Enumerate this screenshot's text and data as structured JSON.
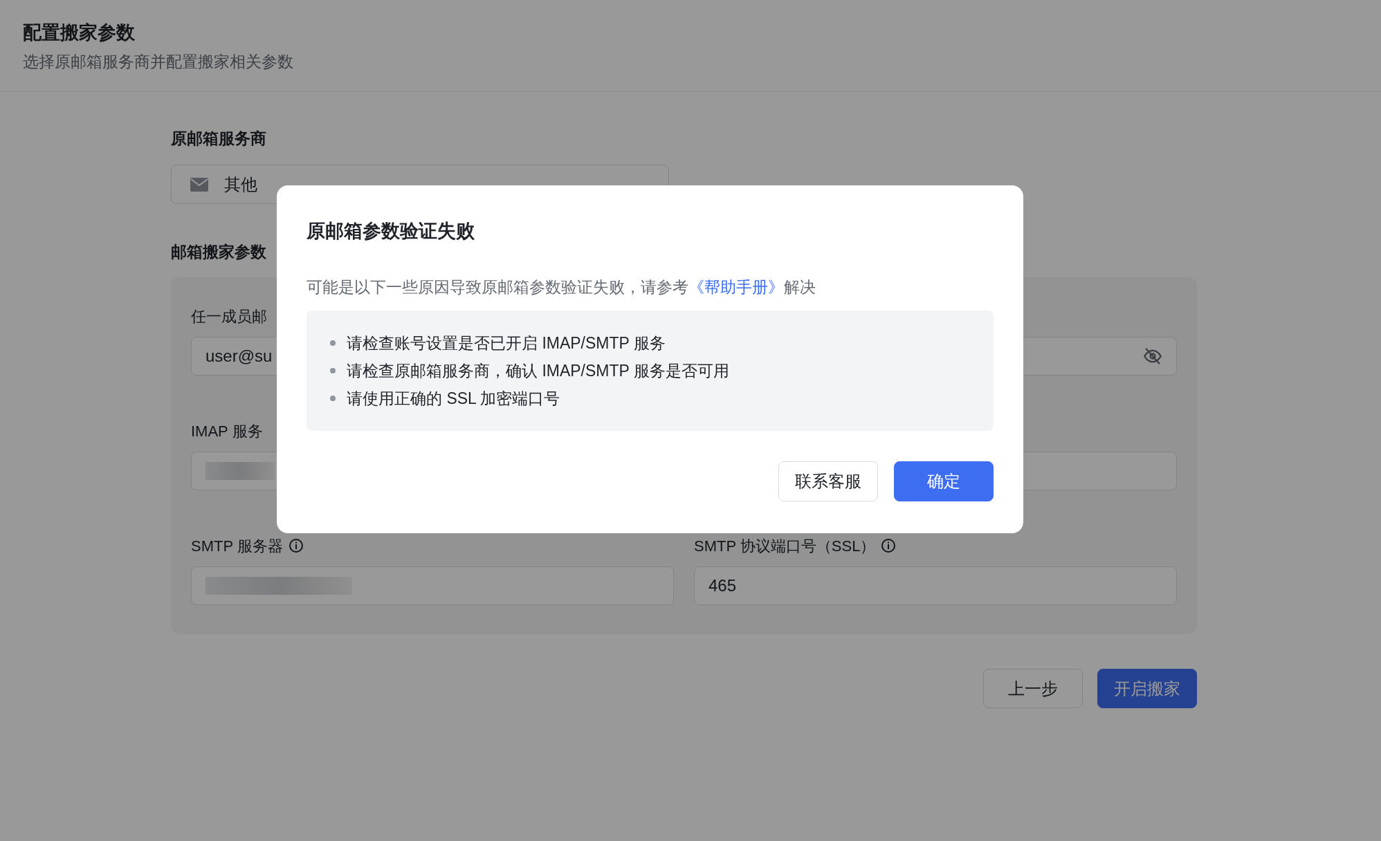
{
  "page": {
    "title": "配置搬家参数",
    "subtitle": "选择原邮箱服务商并配置搬家相关参数"
  },
  "provider": {
    "label": "原邮箱服务商",
    "value": "其他"
  },
  "params": {
    "heading": "邮箱搬家参数",
    "fields": [
      {
        "kind": "text",
        "label": "任一成员邮",
        "value": "user@su"
      },
      {
        "kind": "password"
      },
      {
        "kind": "redacted",
        "label": "IMAP 服务"
      },
      {
        "kind": "text"
      },
      {
        "kind": "redacted",
        "label": "SMTP 服务器",
        "info": true
      },
      {
        "kind": "text",
        "label": "SMTP 协议端口号（SSL）",
        "info": true,
        "value": "465"
      }
    ]
  },
  "footer_buttons": [
    {
      "kind": "secondary",
      "label": "上一步"
    },
    {
      "kind": "primary",
      "label": "开启搬家"
    }
  ],
  "dialog": {
    "title": "原邮箱参数验证失败",
    "description_before": "可能是以下一些原因导致原邮箱参数验证失败，请参考",
    "link": "《帮助手册》",
    "description_after": "解决",
    "tips": [
      "请检查账号设置是否已开启 IMAP/SMTP 服务",
      "请检查原邮箱服务商，确认 IMAP/SMTP 服务是否可用",
      "请使用正确的 SSL 加密端口号"
    ],
    "buttons": [
      {
        "kind": "secondary",
        "label": "联系客服"
      },
      {
        "kind": "primary",
        "label": "确定"
      }
    ]
  }
}
